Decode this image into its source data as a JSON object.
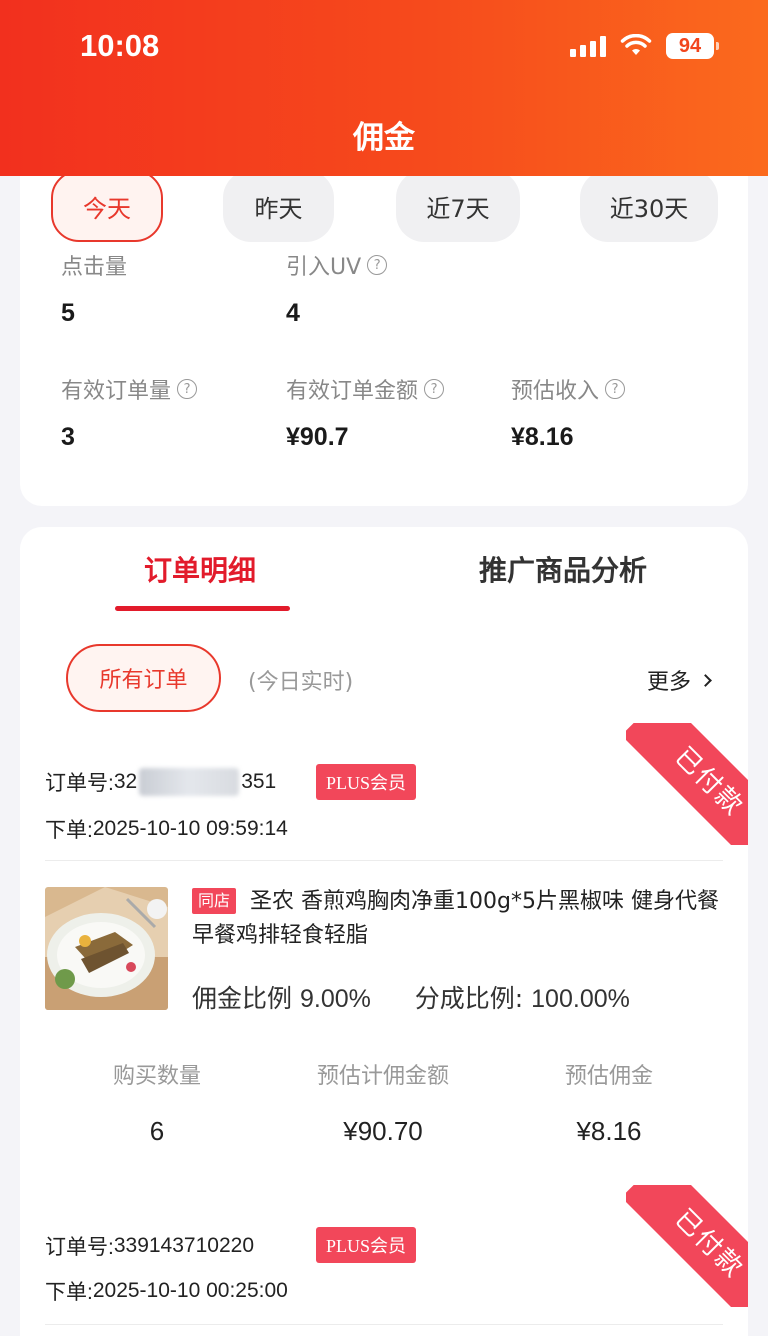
{
  "status_bar": {
    "time": "10:08",
    "battery": "94"
  },
  "header": {
    "title": "佣金"
  },
  "date_filters": [
    "今天",
    "昨天",
    "近7天",
    "近30天"
  ],
  "stats": {
    "clicks": {
      "label": "点击量",
      "value": "5"
    },
    "uv": {
      "label": "引入UV",
      "value": "4"
    },
    "valid_orders": {
      "label": "有效订单量",
      "value": "3"
    },
    "valid_amount": {
      "label": "有效订单金额",
      "value": "¥90.7"
    },
    "est_income": {
      "label": "预估收入",
      "value": "¥8.16"
    }
  },
  "tabs": [
    "订单明细",
    "推广商品分析"
  ],
  "filter": {
    "all_orders": "所有订单",
    "realtime": "(今日实时)",
    "more": "更多"
  },
  "orders": [
    {
      "order_no_label": "订单号:",
      "order_no_prefix": "32",
      "order_no_suffix": "351",
      "member_badge": "PLUS会员",
      "status": "已付款",
      "order_time_label": "下单:",
      "order_time": "2025-10-10 09:59:14",
      "shop_tag": "同店",
      "product_title": "圣农 香煎鸡胸肉净重100g*5片黑椒味 健身代餐 早餐鸡排轻食轻脂",
      "commission_rate_label": "佣金比例",
      "commission_rate": "9.00%",
      "share_rate_label": "分成比例:",
      "share_rate": "100.00%",
      "metrics": [
        {
          "label": "购买数量",
          "value": "6"
        },
        {
          "label": "预估计佣金额",
          "value": "¥90.70"
        },
        {
          "label": "预估佣金",
          "value": "¥8.16"
        }
      ]
    },
    {
      "order_no_label": "订单号:",
      "order_no": "339143710220",
      "member_badge": "PLUS会员",
      "status": "已付款",
      "order_time_label": "下单:",
      "order_time": "2025-10-10 00:25:00"
    }
  ]
}
